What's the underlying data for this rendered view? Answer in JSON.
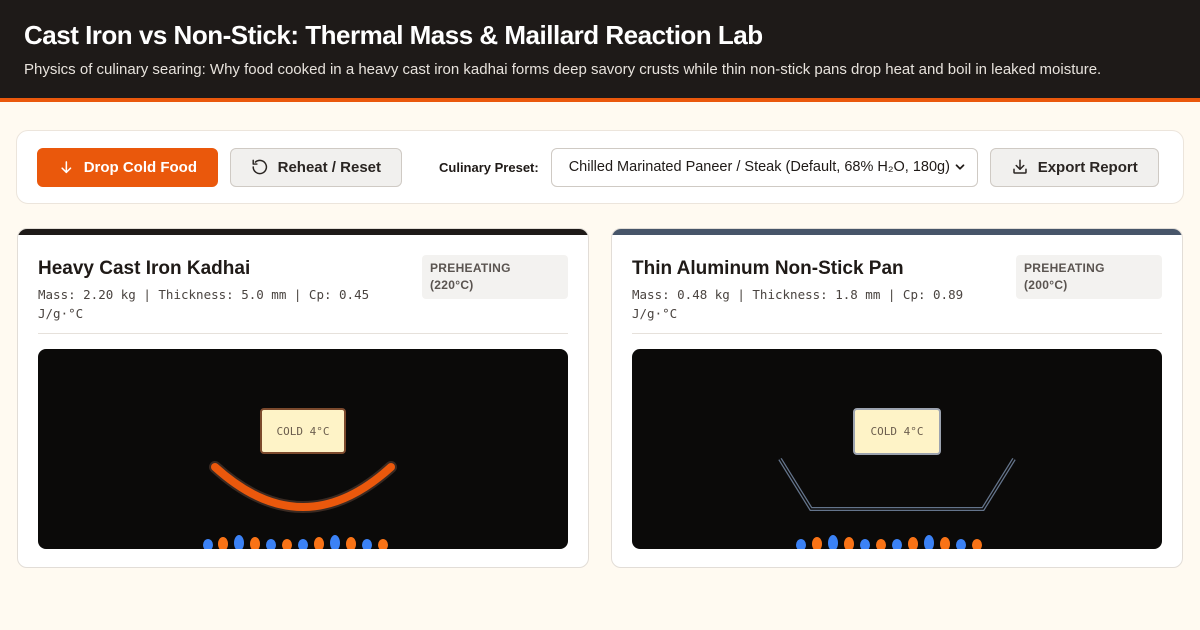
{
  "header": {
    "title": "Cast Iron vs Non-Stick: Thermal Mass & Maillard Reaction Lab",
    "subtitle": "Physics of culinary searing: Why food cooked in a heavy cast iron kadhai forms deep savory crusts while thin non-stick pans drop heat and boil in leaked moisture."
  },
  "toolbar": {
    "drop_label": "Drop Cold Food",
    "reset_label": "Reheat / Reset",
    "preset_label": "Culinary Preset:",
    "preset_value": "Chilled Marinated Paneer / Steak (Default, 68% H₂O, 180g)",
    "export_label": "Export Report"
  },
  "panels": [
    {
      "title": "Heavy Cast Iron Kadhai",
      "meta": "Mass: 2.20 kg | Thickness: 5.0 mm | Cp: 0.45 J/g·°C",
      "status_line1": "PREHEATING",
      "status_line2": "(220°C)",
      "food_label": "COLD 4°C",
      "accent": "#1e1a18",
      "pan_color": "#ea580c"
    },
    {
      "title": "Thin Aluminum Non-Stick Pan",
      "meta": "Mass: 0.48 kg | Thickness: 1.8 mm | Cp: 0.89 J/g·°C",
      "status_line1": "PREHEATING",
      "status_line2": "(200°C)",
      "food_label": "COLD 4°C",
      "accent": "#475569",
      "pan_color": "#64748b"
    }
  ],
  "colors": {
    "brand": "#ea580c",
    "flame_blue": "#3b82f6",
    "flame_orange": "#f97316"
  }
}
